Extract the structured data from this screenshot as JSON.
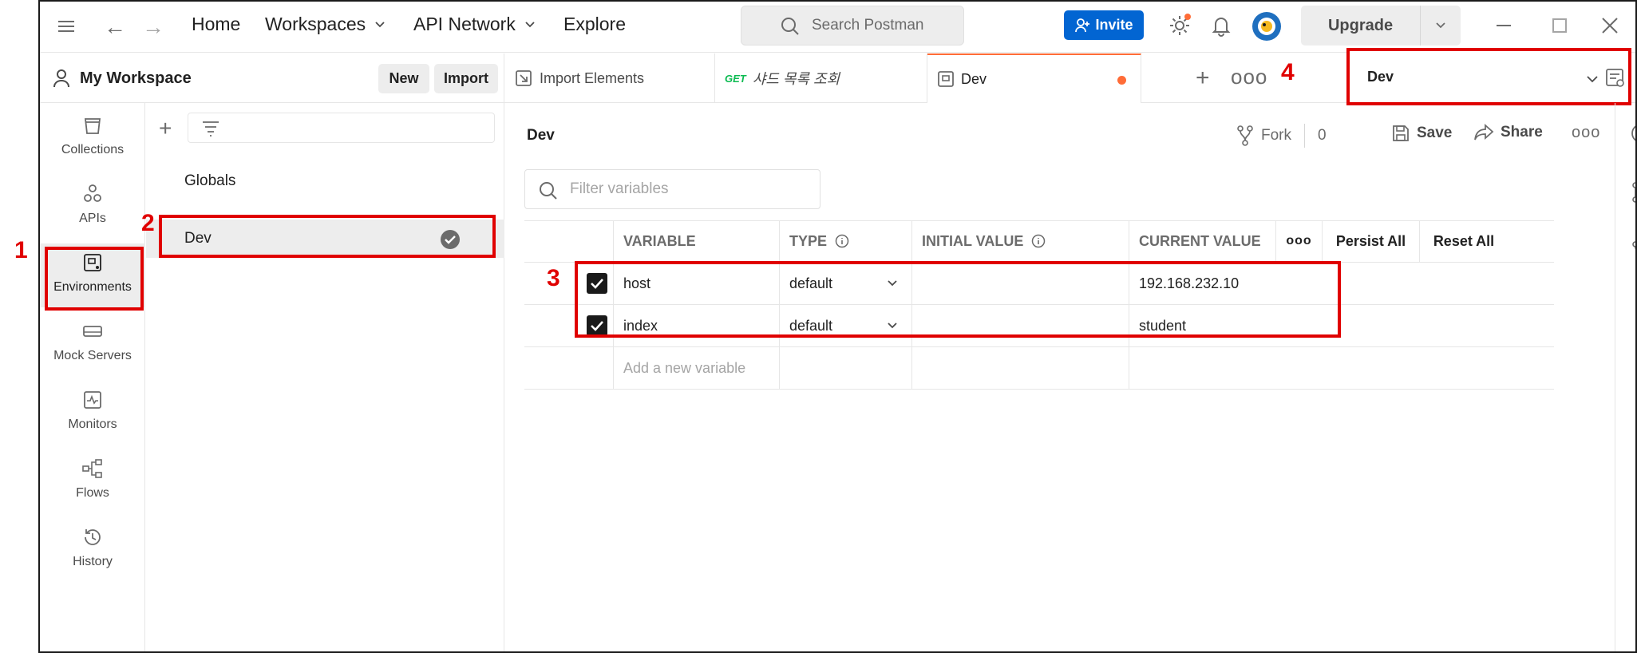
{
  "header": {
    "nav": [
      "Home",
      "Workspaces",
      "API Network",
      "Explore"
    ],
    "search_placeholder": "Search Postman",
    "invite_label": "Invite",
    "upgrade_label": "Upgrade"
  },
  "workspace": {
    "title": "My Workspace",
    "new_label": "New",
    "import_label": "Import"
  },
  "tabs": [
    {
      "label": "Import Elements"
    },
    {
      "method": "GET",
      "label": "샤드 목록 조회"
    },
    {
      "label": "Dev"
    }
  ],
  "environment_selector": {
    "value": "Dev"
  },
  "sidebar": {
    "items": [
      {
        "label": "Collections"
      },
      {
        "label": "APIs"
      },
      {
        "label": "Environments"
      },
      {
        "label": "Mock Servers"
      },
      {
        "label": "Monitors"
      },
      {
        "label": "Flows"
      },
      {
        "label": "History"
      }
    ]
  },
  "env_list": [
    "Globals",
    "Dev"
  ],
  "main": {
    "env_name": "Dev",
    "fork_label": "Fork",
    "fork_count": "0",
    "save_label": "Save",
    "share_label": "Share",
    "filter_placeholder": "Filter variables"
  },
  "table": {
    "columns": [
      "VARIABLE",
      "TYPE",
      "INITIAL VALUE",
      "CURRENT VALUE"
    ],
    "persist_all": "Persist All",
    "reset_all": "Reset All",
    "rows": [
      {
        "variable": "host",
        "type": "default",
        "initial": "",
        "current": "192.168.232.10"
      },
      {
        "variable": "index",
        "type": "default",
        "initial": "",
        "current": "student"
      }
    ],
    "add_placeholder": "Add a new variable"
  },
  "annotations": [
    "1",
    "2",
    "3",
    "4"
  ],
  "colors": {
    "accent": "#ff6c37",
    "invite": "#0265d2",
    "annotation": "#e00000"
  }
}
